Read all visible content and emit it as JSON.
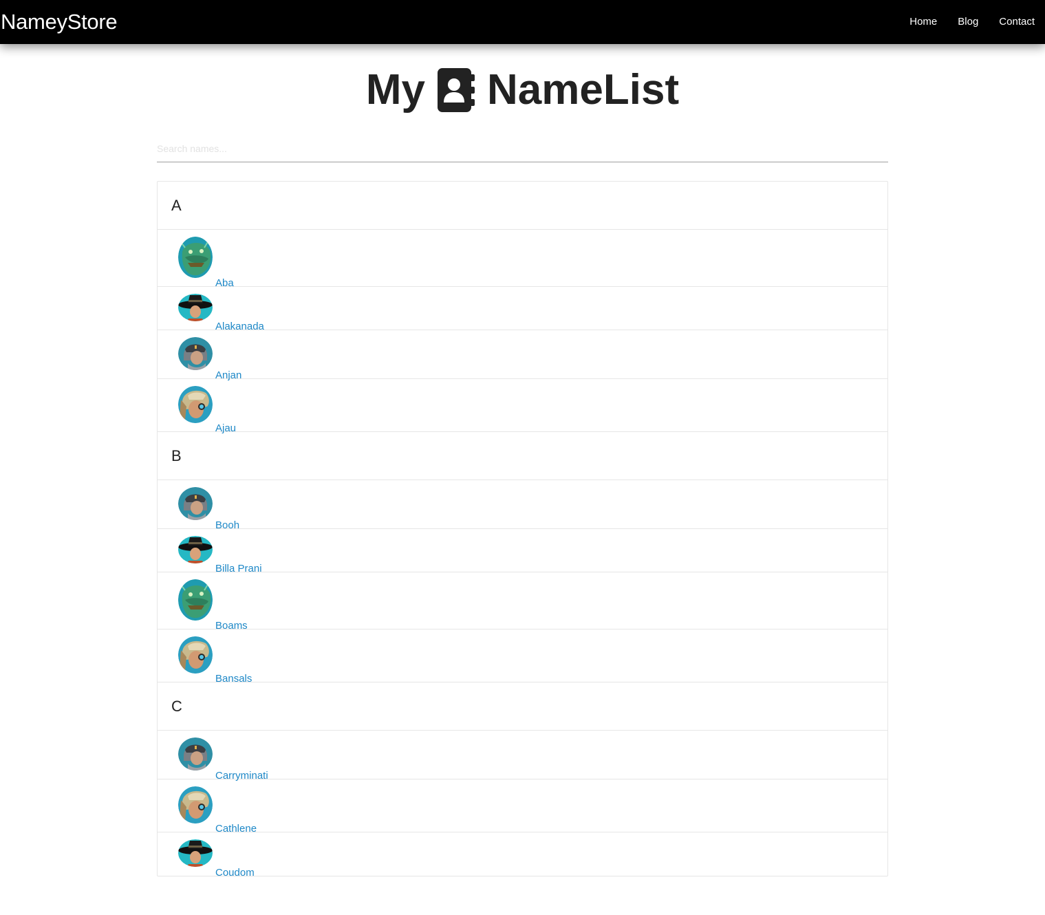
{
  "nav": {
    "brand": "NameyStore",
    "links": [
      "Home",
      "Blog",
      "Contact"
    ]
  },
  "title": {
    "before": "My",
    "icon": "address-book-icon",
    "after": "NameList"
  },
  "search": {
    "placeholder": "Search names...",
    "value": ""
  },
  "groups": [
    {
      "letter": "A",
      "items": [
        {
          "name": "Aba",
          "avatar": "green-reptile-avatar"
        },
        {
          "name": "Alakanada",
          "avatar": "black-hat-avatar"
        },
        {
          "name": "Anjan",
          "avatar": "gray-helmet-avatar"
        },
        {
          "name": "Ajau",
          "avatar": "gold-helmet-avatar"
        }
      ]
    },
    {
      "letter": "B",
      "items": [
        {
          "name": "Booh",
          "avatar": "gray-helmet-avatar"
        },
        {
          "name": "Billa Prani",
          "avatar": "black-hat-avatar"
        },
        {
          "name": "Boams",
          "avatar": "green-reptile-avatar"
        },
        {
          "name": "Bansals",
          "avatar": "gold-helmet-avatar"
        }
      ]
    },
    {
      "letter": "C",
      "items": [
        {
          "name": "Carryminati",
          "avatar": "gray-helmet-avatar"
        },
        {
          "name": "Cathlene",
          "avatar": "gold-helmet-avatar"
        },
        {
          "name": "Coudom",
          "avatar": "black-hat-avatar"
        }
      ]
    }
  ],
  "colors": {
    "navbar": "#000000",
    "link": "#1e88c7",
    "divider": "#e6e6e6"
  }
}
